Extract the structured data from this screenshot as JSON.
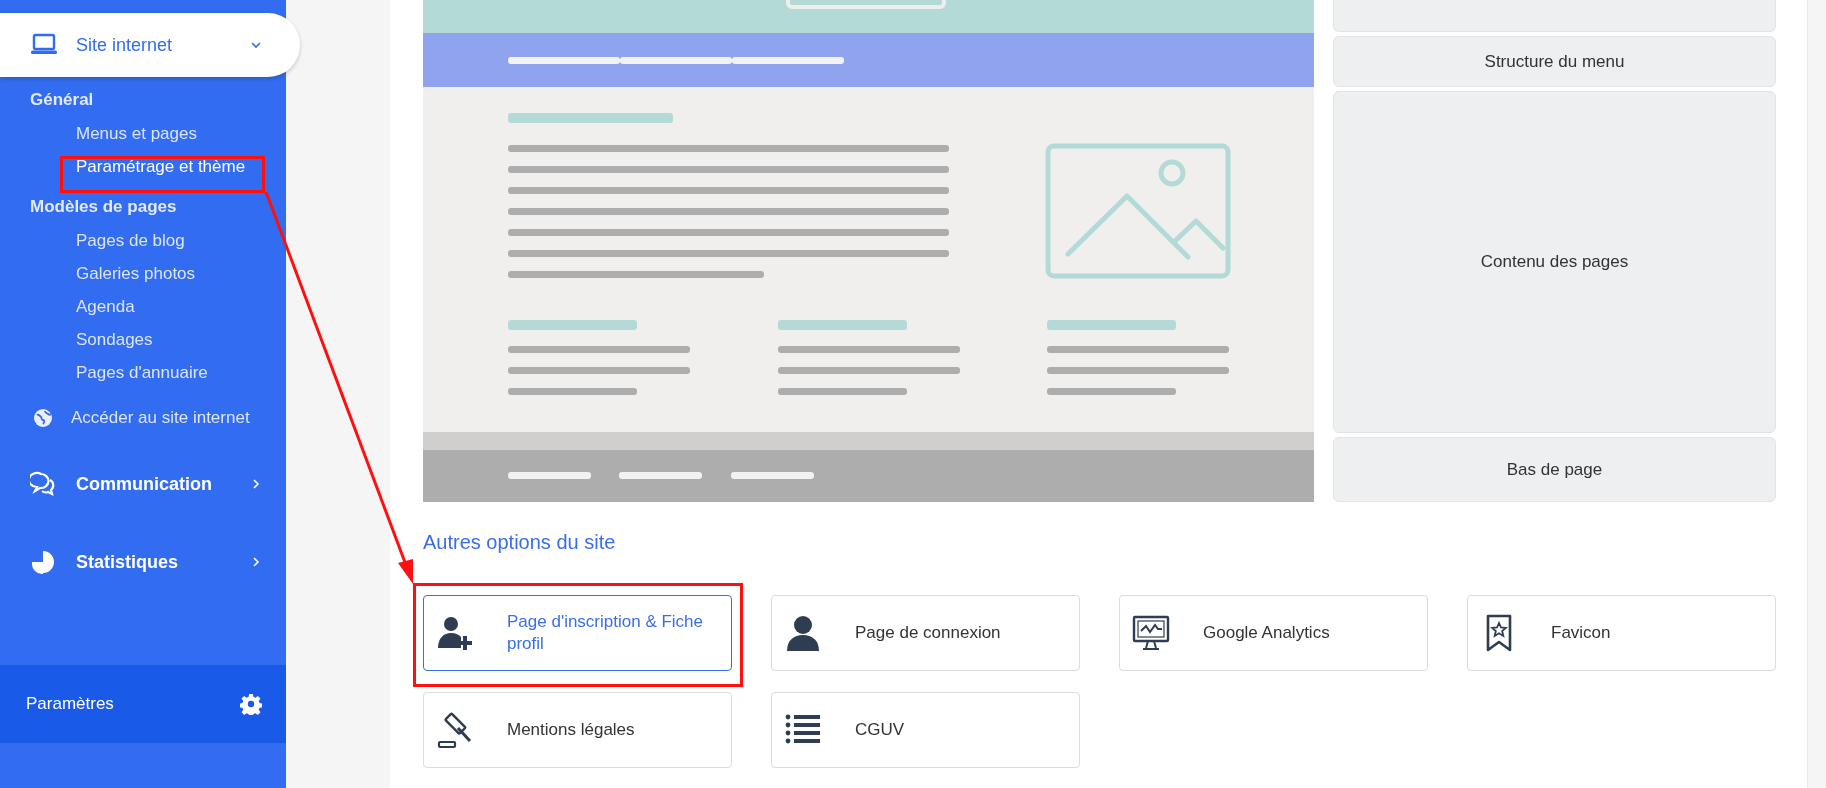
{
  "sidebar": {
    "sections": [
      {
        "label": "Site internet",
        "expanded": true,
        "groups": [
          {
            "heading": "Général",
            "items": [
              {
                "label": "Menus et pages",
                "selected": false
              },
              {
                "label": "Paramétrage et thème",
                "selected": true
              }
            ]
          },
          {
            "heading": "Modèles de pages",
            "items": [
              {
                "label": "Pages de blog",
                "selected": false
              },
              {
                "label": "Galeries photos",
                "selected": false
              },
              {
                "label": "Agenda",
                "selected": false
              },
              {
                "label": "Sondages",
                "selected": false
              },
              {
                "label": "Pages d'annuaire",
                "selected": false
              }
            ]
          }
        ],
        "link": "Accéder au site internet"
      },
      {
        "label": "Communication",
        "expanded": false
      },
      {
        "label": "Statistiques",
        "expanded": false
      }
    ],
    "footer": "Paramètres"
  },
  "layout_preview": {
    "zones": [
      "Structure du menu",
      "Contenu des pages",
      "Bas de page"
    ]
  },
  "options": {
    "heading": "Autres options du site",
    "items": [
      {
        "label": "Page d'inscription & Fiche profil",
        "selected": true
      },
      {
        "label": "Page de connexion",
        "selected": false
      },
      {
        "label": "Google Analytics",
        "selected": false
      },
      {
        "label": "Favicon",
        "selected": false
      },
      {
        "label": "Mentions légales",
        "selected": false
      },
      {
        "label": "CGUV",
        "selected": false
      }
    ]
  }
}
